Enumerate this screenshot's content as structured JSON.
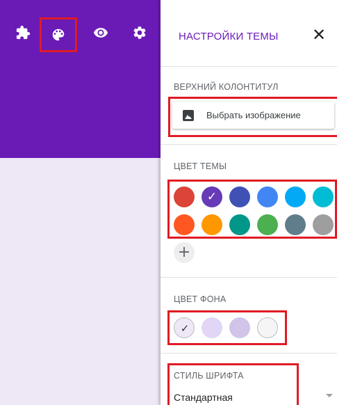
{
  "toolbar": {
    "icons": [
      "puzzle-icon",
      "palette-icon",
      "eye-icon",
      "gear-icon"
    ],
    "highlighted": "palette-icon"
  },
  "panel": {
    "title": "НАСТРОЙКИ ТЕМЫ",
    "close_label": "✕",
    "header_section": {
      "label": "ВЕРХНИЙ КОЛОНТИТУЛ",
      "button_label": "Выбрать изображение"
    },
    "theme_color_section": {
      "label": "ЦВЕТ ТЕМЫ",
      "colors": [
        "#db4437",
        "#673ab7",
        "#3f51b5",
        "#4285f4",
        "#03a9f4",
        "#00bcd4",
        "#ff5722",
        "#ff9800",
        "#009688",
        "#4caf50",
        "#607d8b",
        "#9e9e9e"
      ],
      "selected_color": "#673ab7",
      "add_label": "+"
    },
    "background_section": {
      "label": "ЦВЕТ ФОНА",
      "colors": [
        "#ede7f6",
        "#e1d6f5",
        "#d1c4e9",
        "#f5f5f5"
      ],
      "selected_color": "#ede7f6"
    },
    "font_section": {
      "label": "СТИЛЬ ШРИФТА",
      "value": "Стандартная"
    }
  },
  "colors": {
    "accent": "#6a1bb6",
    "highlight": "#e01b24",
    "form_background": "#ede7f6"
  }
}
